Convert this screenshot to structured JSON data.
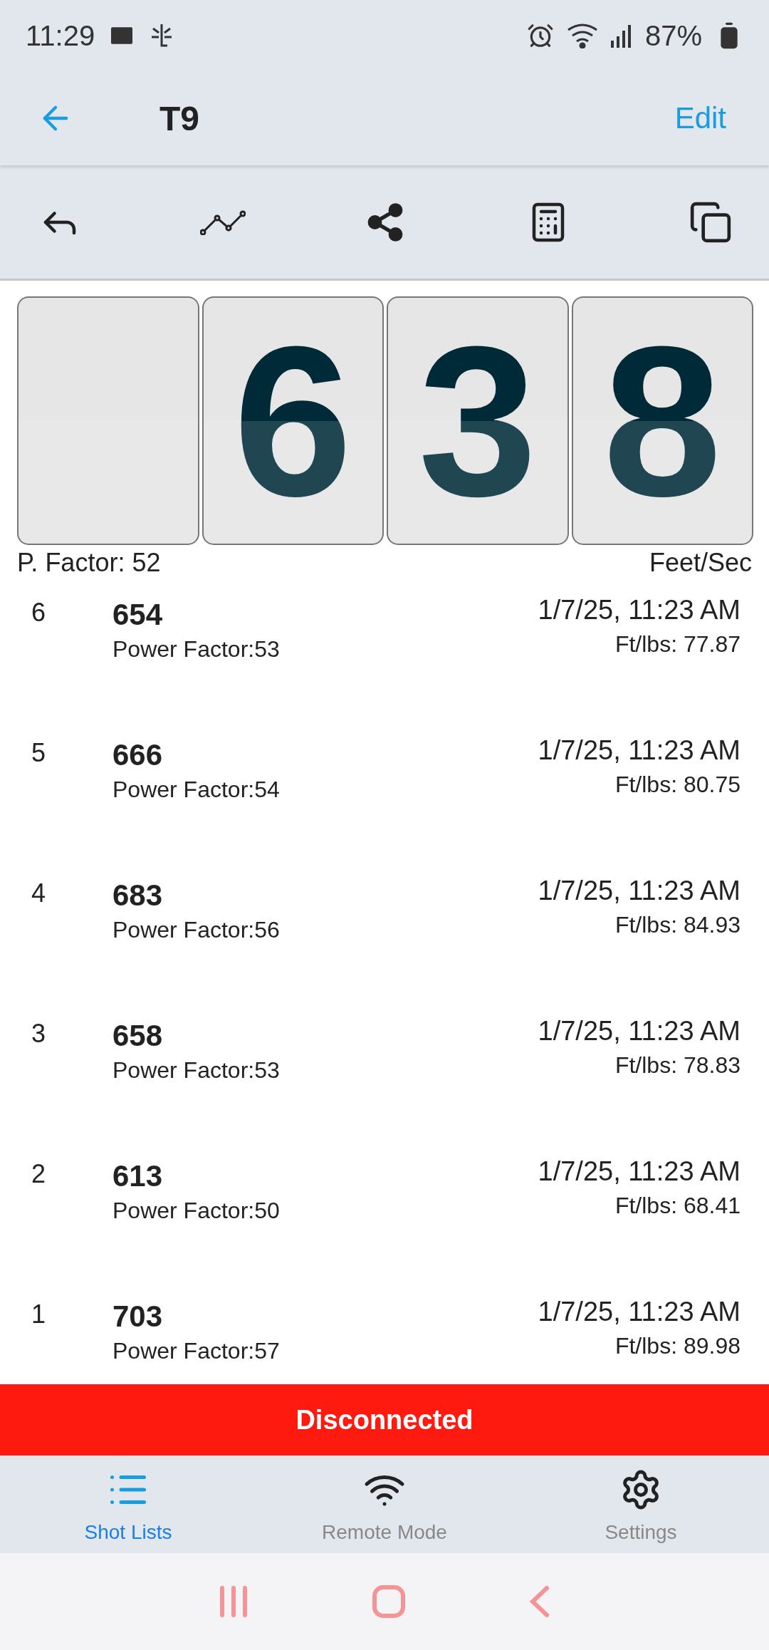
{
  "status_bar": {
    "time": "11:29",
    "battery": "87%"
  },
  "header": {
    "title": "T9",
    "action": "Edit"
  },
  "display": {
    "digits": [
      "6",
      "3",
      "8"
    ],
    "power_factor": "P. Factor: 52",
    "unit": "Feet/Sec"
  },
  "shots": [
    {
      "number": "6",
      "velocity": "654",
      "power_factor": "Power Factor:53",
      "time": "1/7/25, 11:23 AM",
      "energy": "Ft/lbs: 77.87"
    },
    {
      "number": "5",
      "velocity": "666",
      "power_factor": "Power Factor:54",
      "time": "1/7/25, 11:23 AM",
      "energy": "Ft/lbs: 80.75"
    },
    {
      "number": "4",
      "velocity": "683",
      "power_factor": "Power Factor:56",
      "time": "1/7/25, 11:23 AM",
      "energy": "Ft/lbs: 84.93"
    },
    {
      "number": "3",
      "velocity": "658",
      "power_factor": "Power Factor:53",
      "time": "1/7/25, 11:23 AM",
      "energy": "Ft/lbs: 78.83"
    },
    {
      "number": "2",
      "velocity": "613",
      "power_factor": "Power Factor:50",
      "time": "1/7/25, 11:23 AM",
      "energy": "Ft/lbs: 68.41"
    },
    {
      "number": "1",
      "velocity": "703",
      "power_factor": "Power Factor:57",
      "time": "1/7/25, 11:23 AM",
      "energy": "Ft/lbs: 89.98"
    }
  ],
  "connection_banner": "Disconnected",
  "bottom_nav": [
    {
      "kind": "list",
      "label": "Shot Lists",
      "selected": true
    },
    {
      "kind": "wifi",
      "label": "Remote Mode",
      "selected": false
    },
    {
      "kind": "settings",
      "label": "Settings",
      "selected": false
    }
  ]
}
